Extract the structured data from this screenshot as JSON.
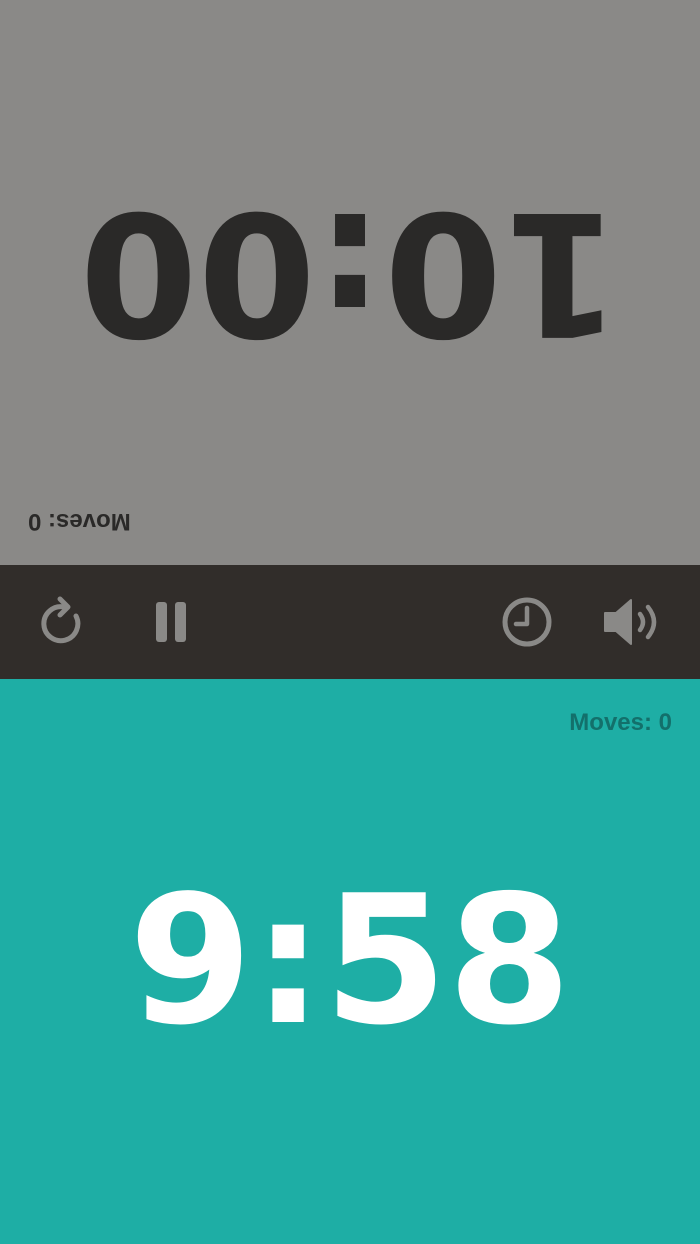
{
  "colors": {
    "top_bg": "#8a8987",
    "top_text": "#2a2928",
    "controls_bg": "#312d2a",
    "icon_color": "#8a8987",
    "bottom_bg": "#1eaea5",
    "bottom_text": "#ffffff",
    "bottom_moves": "#13706b"
  },
  "top_player": {
    "time": "10:00",
    "moves_label": "Moves: 0",
    "rotated": true
  },
  "bottom_player": {
    "time": "9:58",
    "moves_label": "Moves: 0"
  },
  "controls": {
    "icons": [
      "reset-icon",
      "pause-icon",
      "clock-settings-icon",
      "sound-icon"
    ]
  }
}
